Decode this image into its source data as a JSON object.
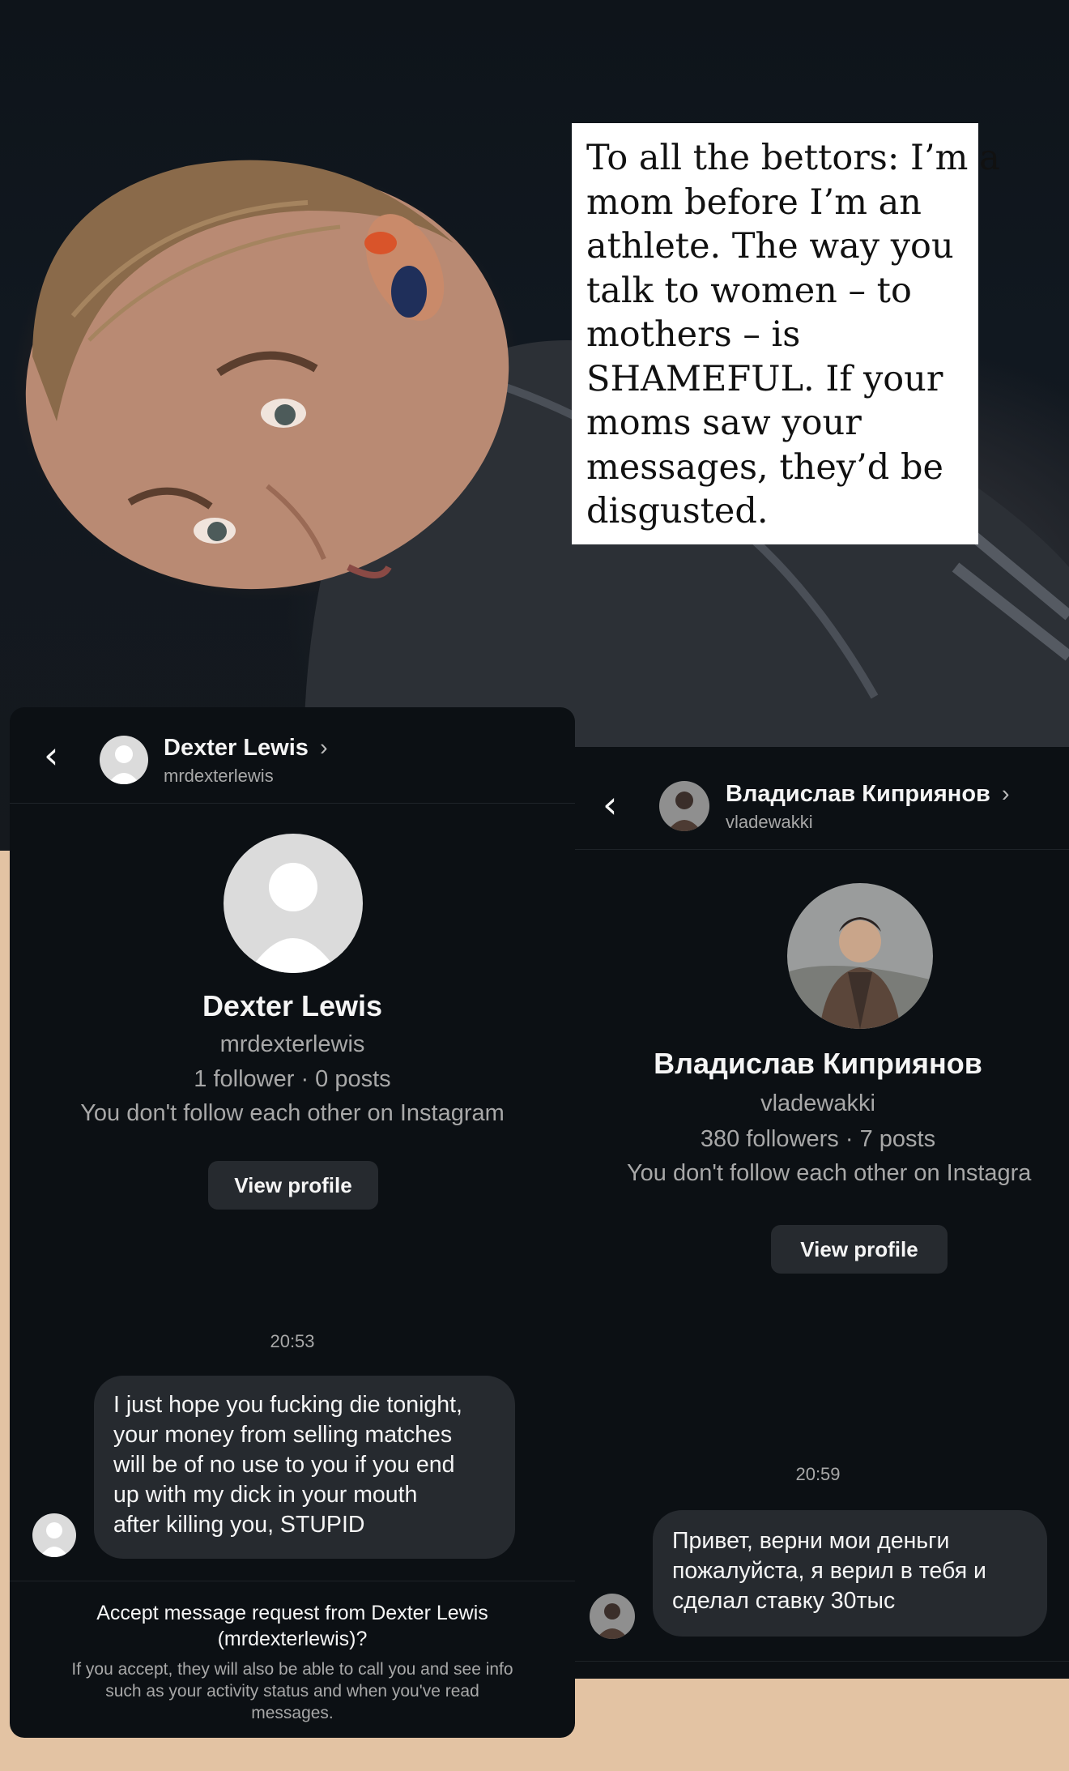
{
  "caption": {
    "lines": [
      "To all the bettors: I’m a",
      "mom before I’m an",
      "athlete. The way you",
      "talk to women – to",
      "mothers – is",
      "SHAMEFUL. If your",
      "moms saw your",
      "messages, they’d be",
      "disgusted."
    ]
  },
  "left_chat": {
    "header": {
      "name": "Dexter Lewis",
      "username": "mrdexterlewis",
      "chevron": "›"
    },
    "profile": {
      "name": "Dexter Lewis",
      "username": "mrdexterlewis",
      "stats": "1 follower · 0 posts",
      "relation": "You don't follow each other on Instagram",
      "button": "View profile"
    },
    "timestamp": "20:53",
    "message_lines": [
      "I just hope you fucking die tonight,",
      "your money from selling matches",
      "will be of no use to you if you end",
      "up with my dick in your mouth",
      "after killing you, STUPID"
    ],
    "request": {
      "title_line1": "Accept message request from Dexter Lewis",
      "title_line2": "(mrdexterlewis)?",
      "note_line1": "If you accept, they will also be able to call you and see info",
      "note_line2": "such as your activity status and when you've read",
      "note_line3": "messages."
    }
  },
  "right_chat": {
    "header": {
      "name": "Владислав Киприянов",
      "username": "vladewakki",
      "chevron": "›"
    },
    "profile": {
      "name": "Владислав Киприянов",
      "username": "vladewakki",
      "stats": "380 followers · 7 posts",
      "relation": "You don't follow each other on Instagra",
      "button": "View profile"
    },
    "timestamp": "20:59",
    "message_lines": [
      "Привет, верни мои деньги",
      "пожалуйста, я верил в тебя и",
      "сделал ставку 30тыс"
    ]
  },
  "icons": {
    "back": "back-chevron-icon",
    "default_avatar": "default-avatar-icon",
    "photo_avatar": "profile-photo-avatar"
  },
  "colors": {
    "panel_bg": "#0c1014",
    "bubble_bg": "#262a2f",
    "muted_text": "#a8a8a8",
    "page_bg": "#e3c3a3",
    "caption_bg": "#ffffff"
  }
}
